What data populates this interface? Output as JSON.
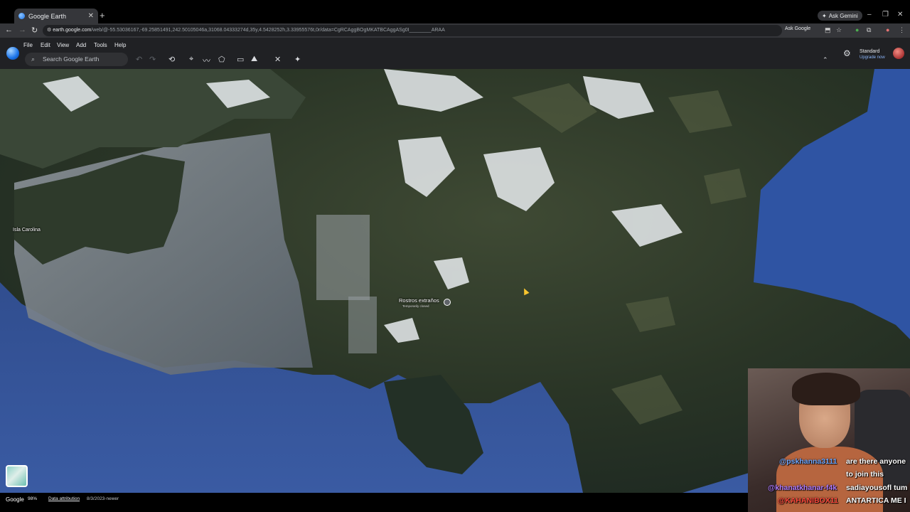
{
  "browser": {
    "tab_title": "Google Earth",
    "new_tab_symbol": "+",
    "gemini_button": "Ask Gemini",
    "url_host": "earth.google.com",
    "url_path": "/web/@-55.53036167,-69.25851491,242.50105046a,31068.04333274d,35y,4.5428252h,3.33955576t,0r/data=CgRCAggBOgMKATBCAggASg0I________ARAA",
    "ask_google": "Ask Google"
  },
  "earth": {
    "menu": [
      "File",
      "Edit",
      "View",
      "Add",
      "Tools",
      "Help"
    ],
    "search_placeholder": "Search Google Earth",
    "plan_label": "Standard",
    "upgrade_label": "Upgrade now"
  },
  "map": {
    "label_island": "Isla Carolina",
    "place_name": "Rostros extraños",
    "place_status": "Temporarily closed"
  },
  "status": {
    "brand": "Google",
    "percent": "98%",
    "data_attribution": "Data attribution",
    "date": "8/3/2023-newer"
  },
  "chat": {
    "messages": [
      {
        "user": "@pskhanna3111",
        "text": "are there anyone"
      },
      {
        "user": "",
        "text": "to join this"
      },
      {
        "user": "@khanatkhanar-f4k",
        "text": "sadiayousofl tum"
      },
      {
        "user": "@KAHANIBOX11",
        "text": "ANTARTICA ME I"
      }
    ]
  },
  "colors": {
    "ocean": "#2d4d91",
    "chrome_dark": "#202124",
    "link_blue": "#8ab4f8",
    "chat_user_blue": "#6fa8ff",
    "chat_user_purple": "#b07cff",
    "chat_user_red": "#ff4a3d"
  },
  "icons": {
    "tools": [
      "history-icon",
      "placemark-icon",
      "path-icon",
      "polygon-icon",
      "ruler-icon",
      "image-overlay-icon",
      "streetview-icon",
      "feeling-lucky-icon"
    ]
  }
}
